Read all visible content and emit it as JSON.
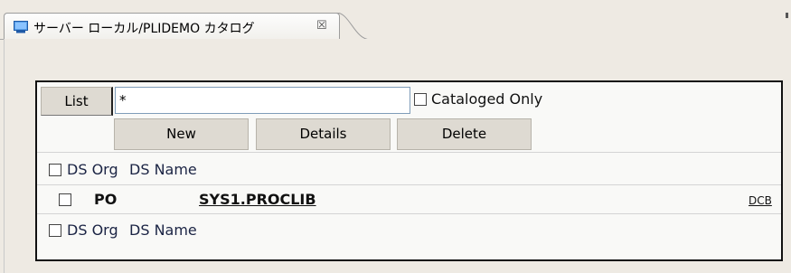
{
  "tab": {
    "title": "サーバー ローカル/PLIDEMO カタログ",
    "close_glyph": "☒"
  },
  "toolbar": {
    "list_label": "List",
    "search_value": "*",
    "cataloged_only_label": "Cataloged Only"
  },
  "actions": {
    "new_label": "New",
    "details_label": "Details",
    "delete_label": "Delete"
  },
  "table": {
    "header": {
      "org": "DS Org",
      "name": "DS Name"
    },
    "rows": [
      {
        "org": "PO",
        "name": "SYS1.PROCLIB",
        "action": "DCB"
      }
    ],
    "footer": {
      "org": "DS Org",
      "name": "DS Name"
    }
  }
}
